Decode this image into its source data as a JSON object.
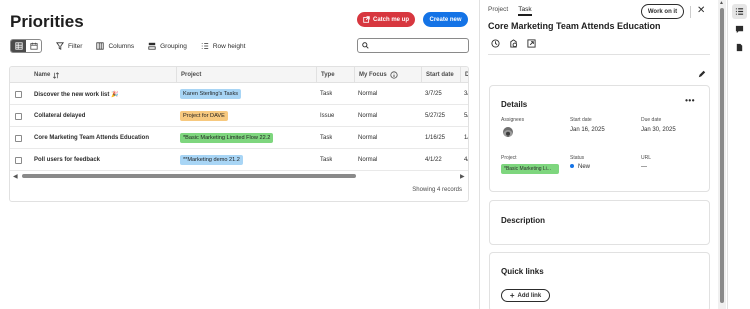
{
  "page": {
    "title": "Priorities",
    "catch_me_up": "Catch me up",
    "create_new": "Create new"
  },
  "toolbar": {
    "filter": "Filter",
    "columns": "Columns",
    "grouping": "Grouping",
    "row_height": "Row height",
    "search_placeholder": ""
  },
  "grid": {
    "columns": [
      "Name",
      "Project",
      "Type",
      "My Focus",
      "Start date",
      "D"
    ],
    "rows": [
      {
        "name": "Discover the new work list 🎉",
        "project": "Karen Sterling's Tasks",
        "project_color": "#a8d5f5",
        "type": "Task",
        "focus": "Normal",
        "start": "3/7/25",
        "due": "3/"
      },
      {
        "name": "Collateral delayed",
        "project": "Project for DAVE",
        "project_color": "#f7c97f",
        "type": "Issue",
        "focus": "Normal",
        "start": "5/27/25",
        "due": "5/"
      },
      {
        "name": "Core Marketing Team Attends Education",
        "project": "*Basic Marketing Limited Flow 22.2",
        "project_color": "#7ed67e",
        "type": "Task",
        "focus": "Normal",
        "start": "1/16/25",
        "due": "1/"
      },
      {
        "name": "Poll users for feedback",
        "project": "**Marketing demo 21.2",
        "project_color": "#a8d5f5",
        "type": "Task",
        "focus": "Normal",
        "start": "4/1/22",
        "due": "4/"
      }
    ],
    "records": "Showing 4 records"
  },
  "detail": {
    "tabs": [
      "Project",
      "Task"
    ],
    "active_tab": "Task",
    "work_on_it": "Work on it",
    "title": "Core Marketing Team Attends Education",
    "details": {
      "heading": "Details",
      "assignees_label": "Assignees",
      "start_label": "Start date",
      "start_value": "Jan 16, 2025",
      "due_label": "Due date",
      "due_value": "Jan 30, 2025",
      "project_label": "Project",
      "project_value": "*Basic Marketing Li...",
      "status_label": "Status",
      "status_value": "New",
      "url_label": "URL",
      "url_value": "—"
    },
    "description_heading": "Description",
    "quick_links_heading": "Quick links",
    "add_link": "Add link"
  },
  "colors": {
    "catch_me_up_bg": "#d7373f",
    "create_new_bg": "#1473e6",
    "status_new": "#1473e6"
  }
}
